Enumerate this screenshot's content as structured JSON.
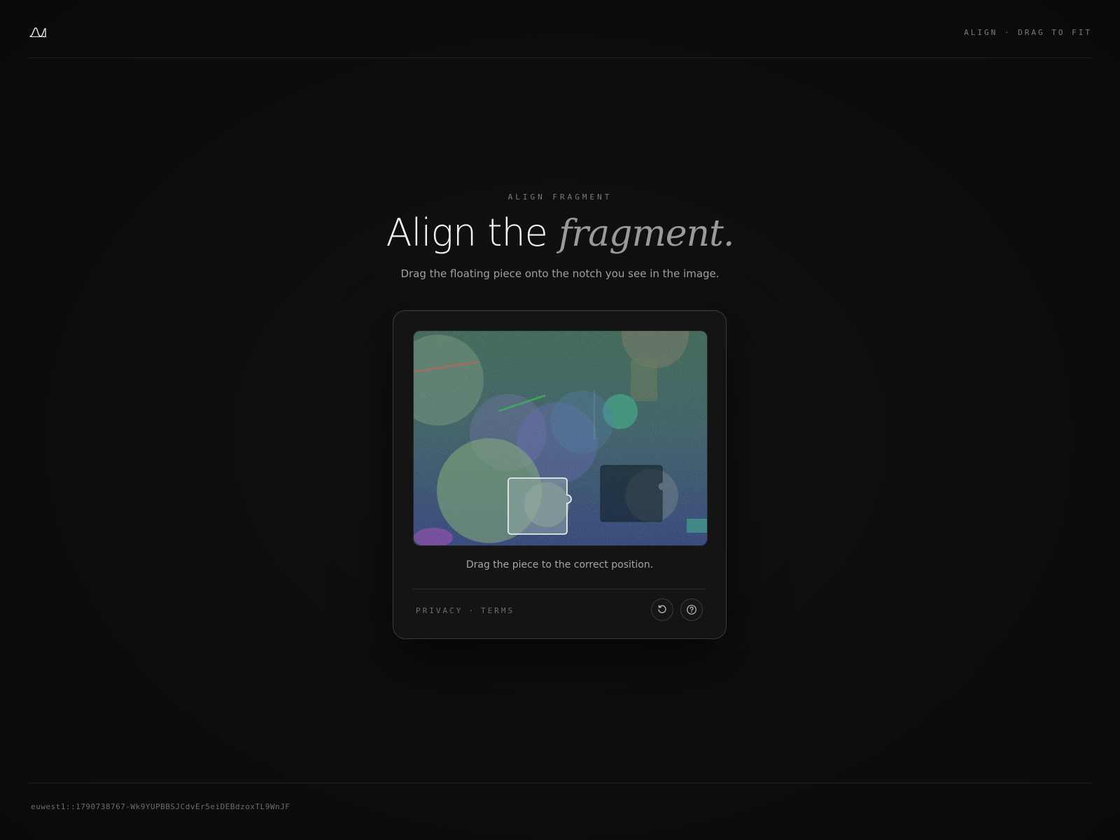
{
  "header": {
    "logo_icon": "wave-logo-icon",
    "tag": "ALIGN · DRAG TO FIT"
  },
  "hero": {
    "eyebrow": "ALIGN FRAGMENT",
    "title_main": "Align the ",
    "title_emphasis": "fragment.",
    "subtitle": "Drag the floating piece onto the notch you see in the image."
  },
  "captcha": {
    "hint": "Drag the piece to the correct position.",
    "links": {
      "privacy": "PRIVACY",
      "separator": "·",
      "terms": "TERMS"
    },
    "buttons": {
      "refresh_icon": "refresh-icon",
      "help_icon": "help-icon"
    }
  },
  "footer": {
    "session_id": "euwest1::1790738767-Wk9YUPBBSJCdvEr5eiDEBdzoxTL9WnJF"
  },
  "colors": {
    "background": "#0b0b0b",
    "card": "#141414",
    "accent_text": "#9a9a9a"
  }
}
